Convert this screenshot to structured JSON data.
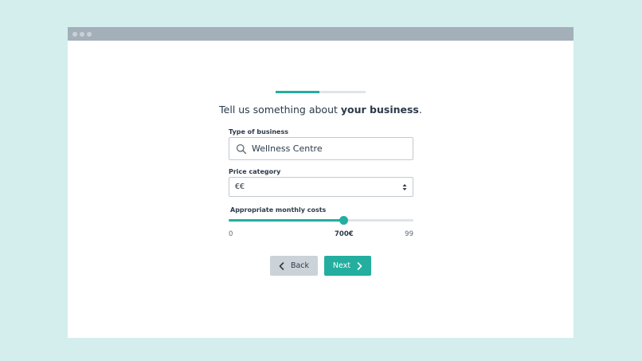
{
  "window": {
    "titlebar_dots": 3
  },
  "progress": {
    "fraction": 0.49
  },
  "heading": {
    "prefix": "Tell us something about ",
    "bold": "your business",
    "suffix": "."
  },
  "business_type": {
    "label": "Type of business",
    "value": "Wellness Centre",
    "icon": "search-icon"
  },
  "price_category": {
    "label": "Price category",
    "selected": "€€",
    "icon": "select-arrows-icon"
  },
  "monthly_costs": {
    "label": "Appropriate monthly costs",
    "min_label": "0",
    "current_label": "700€",
    "max_label": "99",
    "fraction": 0.62
  },
  "buttons": {
    "back_label": "Back",
    "next_label": "Next"
  },
  "colors": {
    "accent": "#23ae9f",
    "background": "#d3eeed",
    "titlebar": "#a3b0b9",
    "back_button": "#cbd3d9"
  }
}
